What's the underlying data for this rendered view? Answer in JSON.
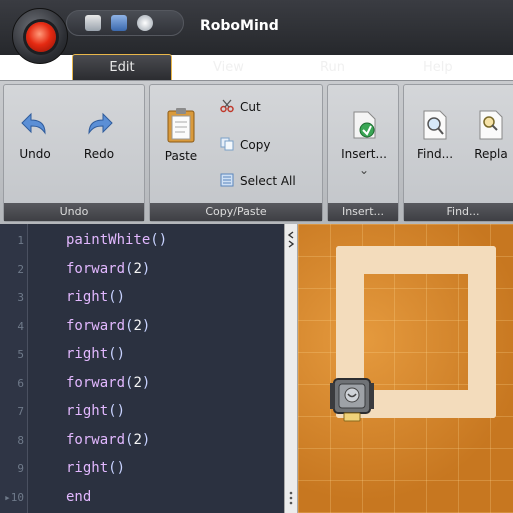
{
  "app": {
    "title": "RoboMind"
  },
  "menu": {
    "tabs": [
      "Edit",
      "View",
      "Run",
      "Help"
    ]
  },
  "ribbon": {
    "undo_group": {
      "label": "Undo",
      "undo": "Undo",
      "redo": "Redo"
    },
    "clipboard_group": {
      "label": "Copy/Paste",
      "paste": "Paste",
      "cut": "Cut",
      "copy": "Copy",
      "select_all": "Select All"
    },
    "insert_group": {
      "label": "Insert...",
      "insert": "Insert...",
      "dropdown": "⌄"
    },
    "find_group": {
      "label": "Find...",
      "find": "Find...",
      "replace": "Repla"
    }
  },
  "editor": {
    "lines": [
      {
        "num": "1",
        "fn": "paintWhite",
        "arg": ""
      },
      {
        "num": "2",
        "fn": "forward",
        "arg": "2"
      },
      {
        "num": "3",
        "fn": "right",
        "arg": ""
      },
      {
        "num": "4",
        "fn": "forward",
        "arg": "2"
      },
      {
        "num": "5",
        "fn": "right",
        "arg": ""
      },
      {
        "num": "6",
        "fn": "forward",
        "arg": "2"
      },
      {
        "num": "7",
        "fn": "right",
        "arg": ""
      },
      {
        "num": "8",
        "fn": "forward",
        "arg": "2"
      },
      {
        "num": "9",
        "fn": "right",
        "arg": ""
      },
      {
        "num": "10",
        "fn": "end",
        "arg": null
      }
    ],
    "current_line_marker": "▸"
  },
  "colors": {
    "accent_orange": "#e8b64a",
    "ground": "#d4862c",
    "paint": "#f3dcbc"
  }
}
